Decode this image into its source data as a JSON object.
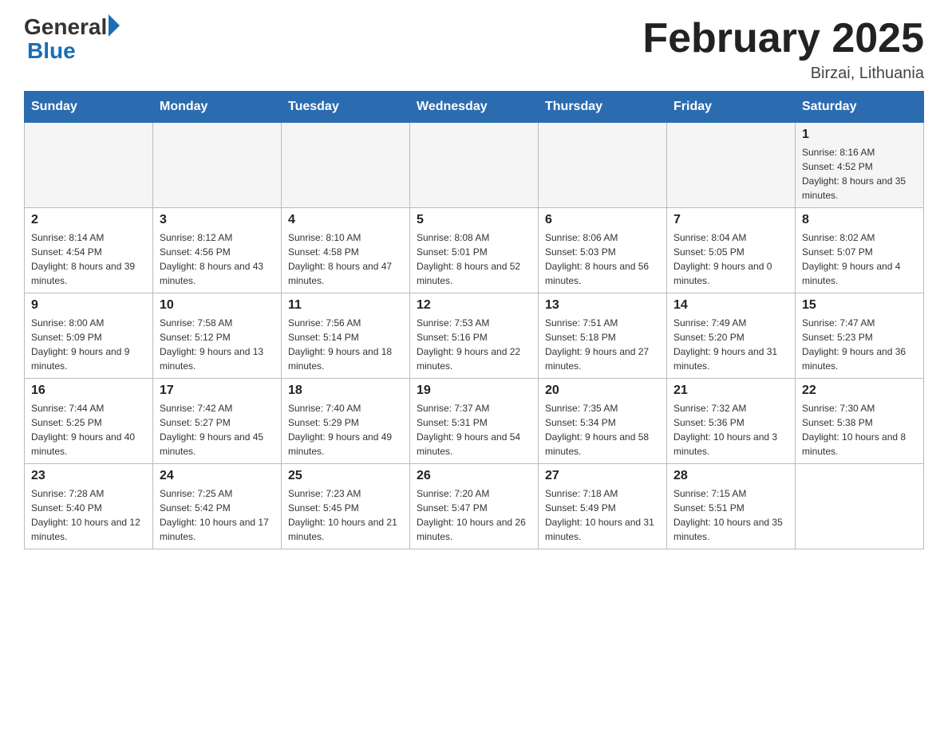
{
  "header": {
    "logo_general": "General",
    "logo_blue": "Blue",
    "month_title": "February 2025",
    "location": "Birzai, Lithuania"
  },
  "weekdays": [
    "Sunday",
    "Monday",
    "Tuesday",
    "Wednesday",
    "Thursday",
    "Friday",
    "Saturday"
  ],
  "weeks": [
    [
      {
        "day": "",
        "info": ""
      },
      {
        "day": "",
        "info": ""
      },
      {
        "day": "",
        "info": ""
      },
      {
        "day": "",
        "info": ""
      },
      {
        "day": "",
        "info": ""
      },
      {
        "day": "",
        "info": ""
      },
      {
        "day": "1",
        "info": "Sunrise: 8:16 AM\nSunset: 4:52 PM\nDaylight: 8 hours and 35 minutes."
      }
    ],
    [
      {
        "day": "2",
        "info": "Sunrise: 8:14 AM\nSunset: 4:54 PM\nDaylight: 8 hours and 39 minutes."
      },
      {
        "day": "3",
        "info": "Sunrise: 8:12 AM\nSunset: 4:56 PM\nDaylight: 8 hours and 43 minutes."
      },
      {
        "day": "4",
        "info": "Sunrise: 8:10 AM\nSunset: 4:58 PM\nDaylight: 8 hours and 47 minutes."
      },
      {
        "day": "5",
        "info": "Sunrise: 8:08 AM\nSunset: 5:01 PM\nDaylight: 8 hours and 52 minutes."
      },
      {
        "day": "6",
        "info": "Sunrise: 8:06 AM\nSunset: 5:03 PM\nDaylight: 8 hours and 56 minutes."
      },
      {
        "day": "7",
        "info": "Sunrise: 8:04 AM\nSunset: 5:05 PM\nDaylight: 9 hours and 0 minutes."
      },
      {
        "day": "8",
        "info": "Sunrise: 8:02 AM\nSunset: 5:07 PM\nDaylight: 9 hours and 4 minutes."
      }
    ],
    [
      {
        "day": "9",
        "info": "Sunrise: 8:00 AM\nSunset: 5:09 PM\nDaylight: 9 hours and 9 minutes."
      },
      {
        "day": "10",
        "info": "Sunrise: 7:58 AM\nSunset: 5:12 PM\nDaylight: 9 hours and 13 minutes."
      },
      {
        "day": "11",
        "info": "Sunrise: 7:56 AM\nSunset: 5:14 PM\nDaylight: 9 hours and 18 minutes."
      },
      {
        "day": "12",
        "info": "Sunrise: 7:53 AM\nSunset: 5:16 PM\nDaylight: 9 hours and 22 minutes."
      },
      {
        "day": "13",
        "info": "Sunrise: 7:51 AM\nSunset: 5:18 PM\nDaylight: 9 hours and 27 minutes."
      },
      {
        "day": "14",
        "info": "Sunrise: 7:49 AM\nSunset: 5:20 PM\nDaylight: 9 hours and 31 minutes."
      },
      {
        "day": "15",
        "info": "Sunrise: 7:47 AM\nSunset: 5:23 PM\nDaylight: 9 hours and 36 minutes."
      }
    ],
    [
      {
        "day": "16",
        "info": "Sunrise: 7:44 AM\nSunset: 5:25 PM\nDaylight: 9 hours and 40 minutes."
      },
      {
        "day": "17",
        "info": "Sunrise: 7:42 AM\nSunset: 5:27 PM\nDaylight: 9 hours and 45 minutes."
      },
      {
        "day": "18",
        "info": "Sunrise: 7:40 AM\nSunset: 5:29 PM\nDaylight: 9 hours and 49 minutes."
      },
      {
        "day": "19",
        "info": "Sunrise: 7:37 AM\nSunset: 5:31 PM\nDaylight: 9 hours and 54 minutes."
      },
      {
        "day": "20",
        "info": "Sunrise: 7:35 AM\nSunset: 5:34 PM\nDaylight: 9 hours and 58 minutes."
      },
      {
        "day": "21",
        "info": "Sunrise: 7:32 AM\nSunset: 5:36 PM\nDaylight: 10 hours and 3 minutes."
      },
      {
        "day": "22",
        "info": "Sunrise: 7:30 AM\nSunset: 5:38 PM\nDaylight: 10 hours and 8 minutes."
      }
    ],
    [
      {
        "day": "23",
        "info": "Sunrise: 7:28 AM\nSunset: 5:40 PM\nDaylight: 10 hours and 12 minutes."
      },
      {
        "day": "24",
        "info": "Sunrise: 7:25 AM\nSunset: 5:42 PM\nDaylight: 10 hours and 17 minutes."
      },
      {
        "day": "25",
        "info": "Sunrise: 7:23 AM\nSunset: 5:45 PM\nDaylight: 10 hours and 21 minutes."
      },
      {
        "day": "26",
        "info": "Sunrise: 7:20 AM\nSunset: 5:47 PM\nDaylight: 10 hours and 26 minutes."
      },
      {
        "day": "27",
        "info": "Sunrise: 7:18 AM\nSunset: 5:49 PM\nDaylight: 10 hours and 31 minutes."
      },
      {
        "day": "28",
        "info": "Sunrise: 7:15 AM\nSunset: 5:51 PM\nDaylight: 10 hours and 35 minutes."
      },
      {
        "day": "",
        "info": ""
      }
    ]
  ]
}
